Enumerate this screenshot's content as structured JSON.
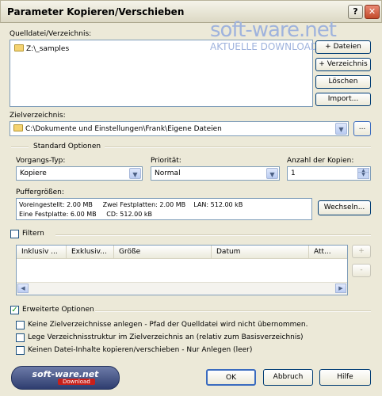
{
  "window": {
    "title": "Parameter Kopieren/Verschieben",
    "help_btn": "?",
    "close_btn": "✕"
  },
  "source": {
    "label": "Quelldatei/Verzeichnis:",
    "items": [
      "Z:\\_samples"
    ],
    "add_files": "+ Dateien",
    "add_dir": "+ Verzeichnis",
    "delete": "Löschen",
    "import": "Import..."
  },
  "target": {
    "label": "Zielverzeichnis:",
    "value": "C:\\Dokumente und Einstellungen\\Frank\\Eigene Dateien",
    "browse": "..."
  },
  "standard": {
    "title": "Standard Optionen",
    "operation_label": "Vorgangs-Typ:",
    "operation_value": "Kopiere",
    "priority_label": "Priorität:",
    "priority_value": "Normal",
    "copies_label": "Anzahl der Kopien:",
    "copies_value": "1"
  },
  "buffer": {
    "label": "Puffergrößen:",
    "line1": "Voreingestellt: 2.00 MB     Zwei Festplatten: 2.00 MB    LAN: 512.00 kB",
    "line2": "Eine Festplatte: 6.00 MB     CD: 512.00 kB",
    "change": "Wechseln..."
  },
  "filter": {
    "label": "Filtern",
    "columns": [
      "Inklusiv ...",
      "Exklusiv...",
      "Größe",
      "Datum",
      "Att..."
    ],
    "add": "+",
    "remove": "-"
  },
  "advanced": {
    "label": "Erweiterte Optionen",
    "checked": true,
    "options": [
      "Keine Zielverzeichnisse anlegen - Pfad der Quelldatei wird nicht übernommen.",
      "Lege Verzeichnisstruktur im Zielverzeichnis an (relativ zum Basisverzeichnis)",
      "Keinen Datei-Inhalte kopieren/verschieben - Nur Anlegen (leer)"
    ]
  },
  "footer": {
    "ok": "OK",
    "cancel": "Abbruch",
    "help": "Hilfe"
  },
  "watermark": {
    "brand": "soft-ware.net",
    "tagline": "AKTUELLE DOWNLOADS",
    "badge_top": "soft-ware.net",
    "badge_bottom": "Download"
  }
}
